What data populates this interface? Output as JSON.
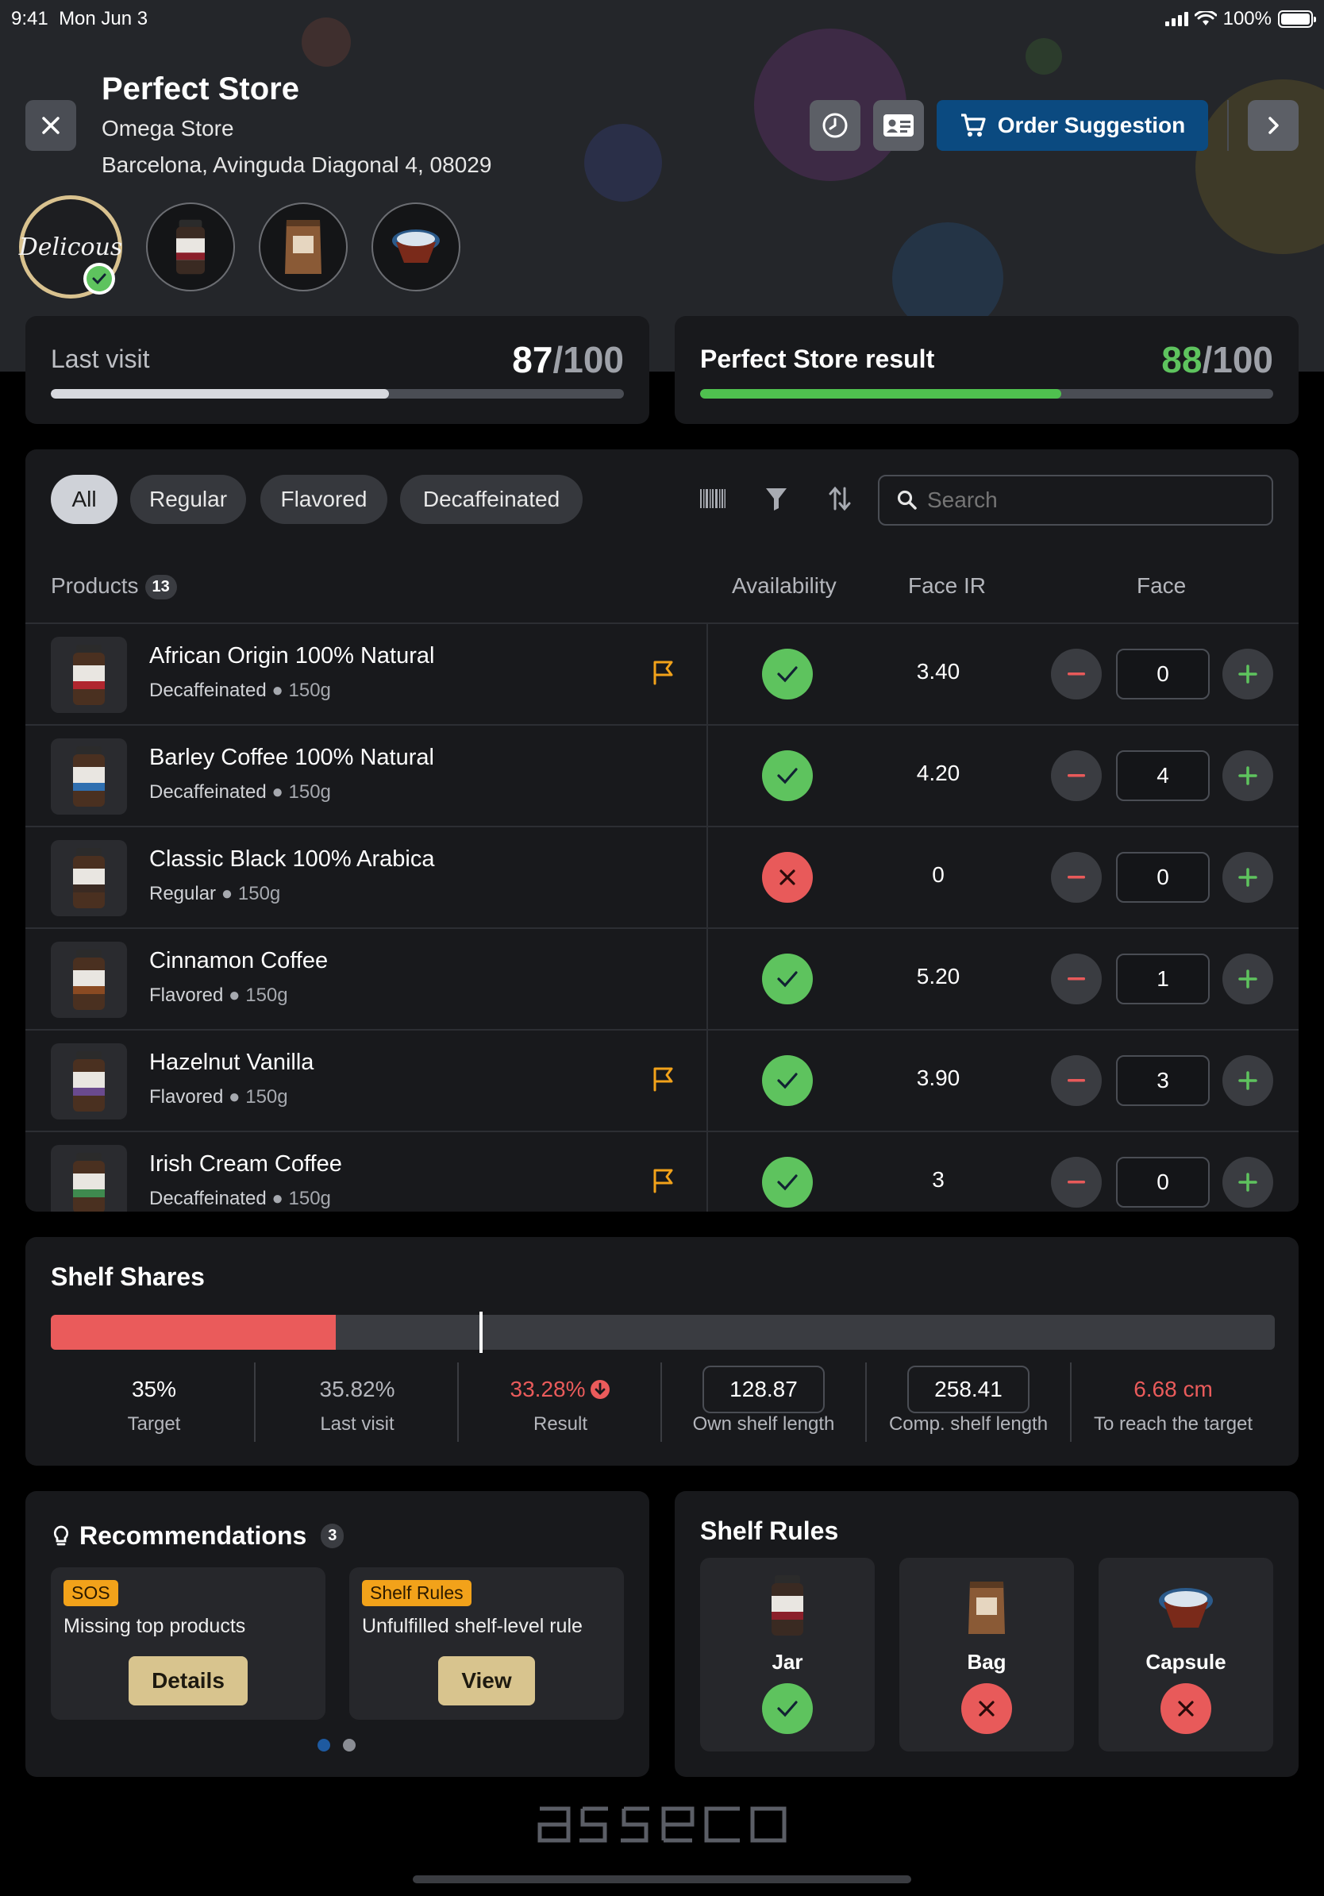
{
  "status_bar": {
    "time": "9:41",
    "date": "Mon Jun 3",
    "battery": "100%"
  },
  "header": {
    "title": "Perfect Store",
    "store_name": "Omega Store",
    "address": "Barcelona, Avinguda Diagonal 4, 08029",
    "order_button_label": "Order Suggestion",
    "brand_logo_text": "Delicous"
  },
  "scores": {
    "last_visit": {
      "label": "Last visit",
      "value": "87",
      "max": "/100",
      "fraction": 0.59,
      "bar_color": "#d7d9de"
    },
    "perfect_store": {
      "label": "Perfect Store result",
      "value": "88",
      "max": "/100",
      "fraction": 0.63,
      "bar_color": "#4fc14f"
    }
  },
  "filters": {
    "chips": [
      "All",
      "Regular",
      "Flavored",
      "Decaffeinated"
    ],
    "active": "All",
    "search_placeholder": "Search"
  },
  "table": {
    "headers": {
      "products": "Products",
      "count": "13",
      "availability": "Availability",
      "face_ir": "Face IR",
      "face": "Face"
    },
    "rows": [
      {
        "name": "African Origin 100% Natural",
        "category": "Decaffeinated",
        "weight": "150g",
        "flag": true,
        "available": true,
        "face_ir": "3.40",
        "face": "0",
        "band": "#b0262e"
      },
      {
        "name": "Barley Coffee 100% Natural",
        "category": "Decaffeinated",
        "weight": "150g",
        "flag": false,
        "available": true,
        "face_ir": "4.20",
        "face": "4",
        "band": "#2f6fb0"
      },
      {
        "name": "Classic Black 100% Arabica",
        "category": "Regular",
        "weight": "150g",
        "flag": false,
        "available": false,
        "face_ir": "0",
        "face": "0",
        "band": "#3a2a22"
      },
      {
        "name": "Cinnamon Coffee",
        "category": "Flavored",
        "weight": "150g",
        "flag": false,
        "available": true,
        "face_ir": "5.20",
        "face": "1",
        "band": "#8a4a22"
      },
      {
        "name": "Hazelnut Vanilla",
        "category": "Flavored",
        "weight": "150g",
        "flag": true,
        "available": true,
        "face_ir": "3.90",
        "face": "3",
        "band": "#6a4a8e"
      },
      {
        "name": "Irish Cream Coffee",
        "category": "Decaffeinated",
        "weight": "150g",
        "flag": true,
        "available": true,
        "face_ir": "3",
        "face": "0",
        "band": "#3f8a4f"
      }
    ]
  },
  "shelf_shares": {
    "title": "Shelf Shares",
    "result_fraction": 0.2328,
    "target_fraction": 0.35,
    "stats": [
      {
        "value": "35%",
        "caption": "Target"
      },
      {
        "value": "35.82%",
        "caption": "Last visit"
      },
      {
        "value": "33.28%",
        "caption": "Result"
      },
      {
        "value": "128.87",
        "caption": "Own shelf length"
      },
      {
        "value": "258.41",
        "caption": "Comp. shelf length"
      },
      {
        "value": "6.68 cm",
        "caption": "To reach the target"
      }
    ]
  },
  "recommendations": {
    "title": "Recommendations",
    "count": "3",
    "items": [
      {
        "tag": "SOS",
        "text": "Missing top products",
        "button": "Details"
      },
      {
        "tag": "Shelf Rules",
        "text": "Unfulfilled shelf-level rule",
        "button": "View"
      }
    ]
  },
  "shelf_rules": {
    "title": "Shelf Rules",
    "items": [
      {
        "label": "Jar",
        "ok": true
      },
      {
        "label": "Bag",
        "ok": false
      },
      {
        "label": "Capsule",
        "ok": false
      }
    ]
  },
  "footer": {
    "logo": "asseco"
  },
  "colors": {
    "accent_blue": "#0b4a80",
    "ok_green": "#5ec35e",
    "error_red": "#e85a5a",
    "flag_orange": "#f2a21a",
    "gold": "#d8c48e"
  }
}
